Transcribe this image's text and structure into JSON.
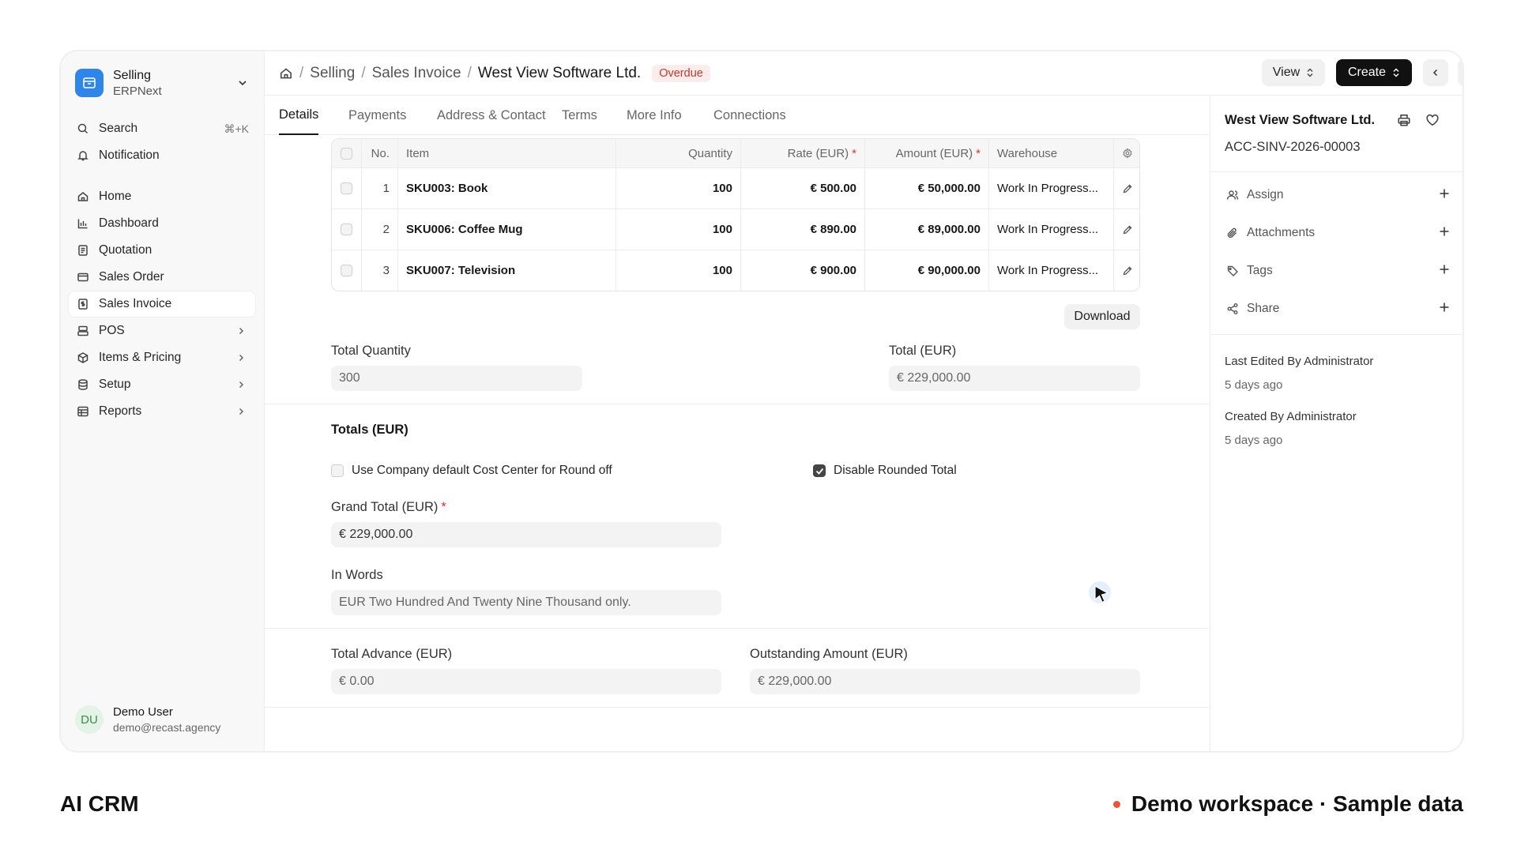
{
  "workspace": {
    "name": "Selling",
    "sub": "ERPNext"
  },
  "sidebar": {
    "search": {
      "label": "Search",
      "shortcut": "⌘+K"
    },
    "notification": "Notification",
    "items": [
      {
        "label": "Home"
      },
      {
        "label": "Dashboard"
      },
      {
        "label": "Quotation"
      },
      {
        "label": "Sales Order"
      },
      {
        "label": "Sales Invoice"
      },
      {
        "label": "POS"
      },
      {
        "label": "Items & Pricing"
      },
      {
        "label": "Setup"
      },
      {
        "label": "Reports"
      }
    ],
    "user": {
      "initials": "DU",
      "name": "Demo User",
      "email": "demo@recast.agency"
    }
  },
  "breadcrumb": {
    "b1": "Selling",
    "b2": "Sales Invoice",
    "current": "West View Software Ltd.",
    "status": "Overdue"
  },
  "toolbar": {
    "view": "View",
    "create": "Create"
  },
  "tabs": [
    "Details",
    "Payments",
    "Address & Contact",
    "Terms",
    "More Info",
    "Connections"
  ],
  "items_table": {
    "headers": {
      "no": "No.",
      "item": "Item",
      "qty": "Quantity",
      "rate": "Rate (EUR)",
      "amount": "Amount (EUR)",
      "warehouse": "Warehouse"
    },
    "rows": [
      {
        "no": "1",
        "item": "SKU003: Book",
        "qty": "100",
        "rate": "€ 500.00",
        "amount": "€ 50,000.00",
        "warehouse": "Work In Progress..."
      },
      {
        "no": "2",
        "item": "SKU006: Coffee Mug",
        "qty": "100",
        "rate": "€ 890.00",
        "amount": "€ 89,000.00",
        "warehouse": "Work In Progress..."
      },
      {
        "no": "3",
        "item": "SKU007: Television",
        "qty": "100",
        "rate": "€ 900.00",
        "amount": "€ 90,000.00",
        "warehouse": "Work In Progress..."
      }
    ],
    "download": "Download"
  },
  "fields": {
    "total_quantity": {
      "label": "Total Quantity",
      "value": "300"
    },
    "total": {
      "label": "Total (EUR)",
      "value": "€ 229,000.00"
    },
    "totals_section": "Totals (EUR)",
    "use_company_cc": "Use Company default Cost Center for Round off",
    "disable_rounded": "Disable Rounded Total",
    "grand_total": {
      "label": "Grand Total (EUR)",
      "value": "€ 229,000.00"
    },
    "in_words": {
      "label": "In Words",
      "value": "EUR Two Hundred And Twenty Nine Thousand only."
    },
    "total_advance": {
      "label": "Total Advance (EUR)",
      "value": "€ 0.00"
    },
    "outstanding": {
      "label": "Outstanding Amount (EUR)",
      "value": "€ 229,000.00"
    }
  },
  "right_panel": {
    "title": "West View Software Ltd.",
    "doc_id": "ACC-SINV-2026-00003",
    "actions": [
      "Assign",
      "Attachments",
      "Tags",
      "Share"
    ],
    "last_edited": "Last Edited By Administrator",
    "last_edited_time": "5 days ago",
    "created": "Created By Administrator",
    "created_time": "5 days ago"
  },
  "footer": {
    "left": "AI CRM",
    "right": "Demo workspace · Sample data"
  },
  "colors": {
    "accent": "#2f86e8",
    "status_overdue": "#c0392b",
    "primary_button": "#111111"
  }
}
